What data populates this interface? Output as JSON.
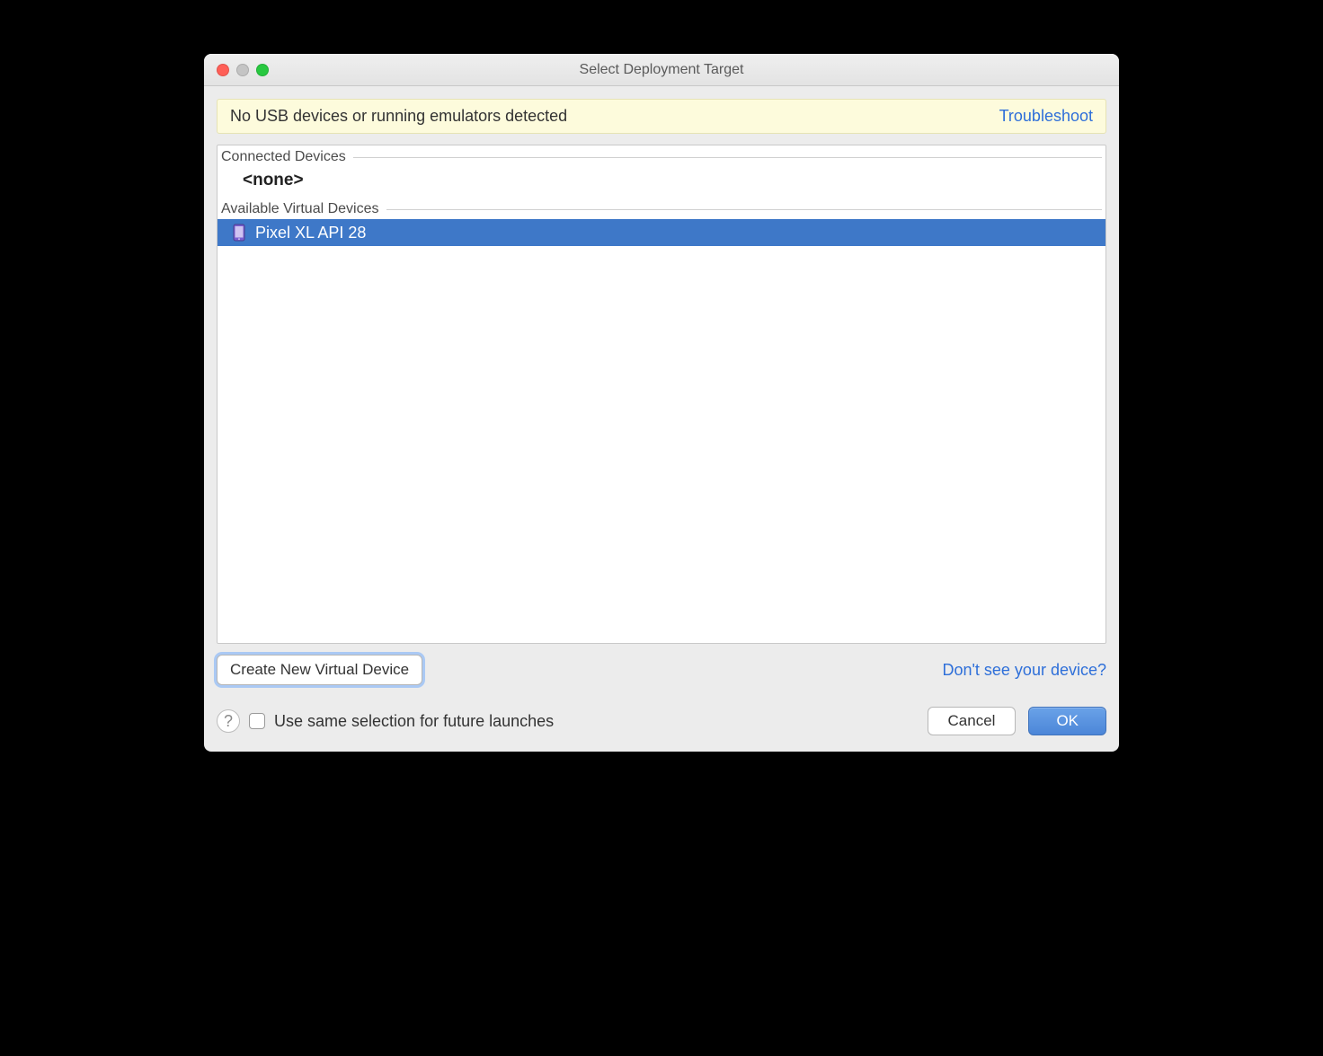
{
  "window": {
    "title": "Select Deployment Target"
  },
  "notice": {
    "message": "No USB devices or running emulators detected",
    "troubleshoot_label": "Troubleshoot"
  },
  "groups": {
    "connected_label": "Connected Devices",
    "connected_none": "<none>",
    "available_label": "Available Virtual Devices",
    "avd_items": [
      {
        "name": "Pixel XL API 28",
        "selected": true
      }
    ]
  },
  "actions": {
    "create_new_label": "Create New Virtual Device",
    "dont_see_label": "Don't see your device?"
  },
  "footer": {
    "help_tooltip": "?",
    "remember_label": "Use same selection for future launches",
    "cancel_label": "Cancel",
    "ok_label": "OK"
  }
}
